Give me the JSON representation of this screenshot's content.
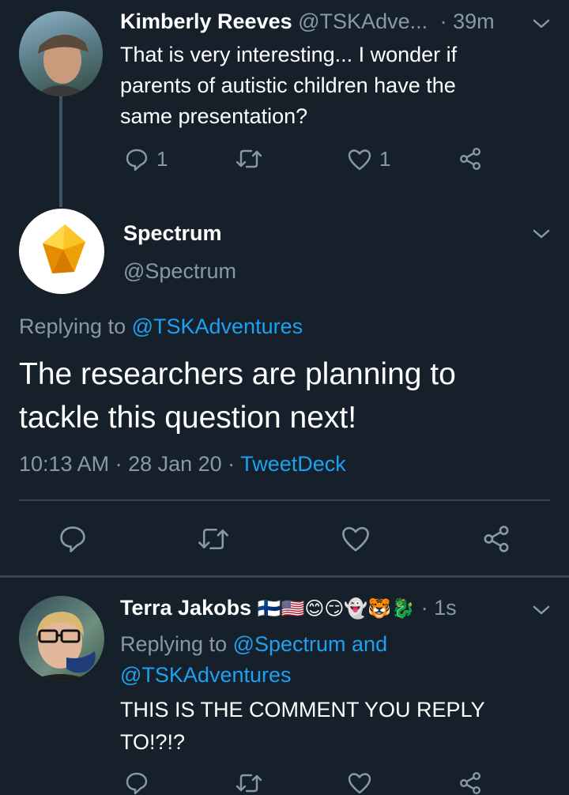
{
  "tweet1": {
    "name": "Kimberly Reeves",
    "handle": "@TSKAdve...",
    "time": "· 39m",
    "text_lines": [
      "That is very interesting... I wonder if",
      "parents of autistic children have the",
      "same presentation?"
    ],
    "reply_count": "1",
    "like_count": "1"
  },
  "tweet2": {
    "name": "Spectrum",
    "handle": "@Spectrum",
    "replying_prefix": "Replying to ",
    "replying_to": "@TSKAdventures",
    "text_lines": [
      "The researchers are planning to",
      "tackle this question next!"
    ],
    "timestamp": "10:13 AM · 28 Jan 20 · ",
    "source": "TweetDeck"
  },
  "tweet3": {
    "name": "Terra Jakobs",
    "name_emojis": "🇫🇮🇺🇸😊😏👻🐯🐉",
    "time": "· 1s",
    "replying_prefix": "Replying to ",
    "replying_to_1": "@Spectrum and",
    "replying_to_2": "@TSKAdventures",
    "text_lines": [
      "THIS IS THE COMMENT YOU REPLY",
      "TO!?!?"
    ]
  },
  "icons": [
    "reply-icon",
    "retweet-icon",
    "like-icon",
    "share-icon",
    "chevron-down-icon"
  ],
  "colors": {
    "background": "#15202b",
    "accent": "#1da1f2",
    "secondary_text": "#8899a6",
    "divider": "#38444d"
  }
}
